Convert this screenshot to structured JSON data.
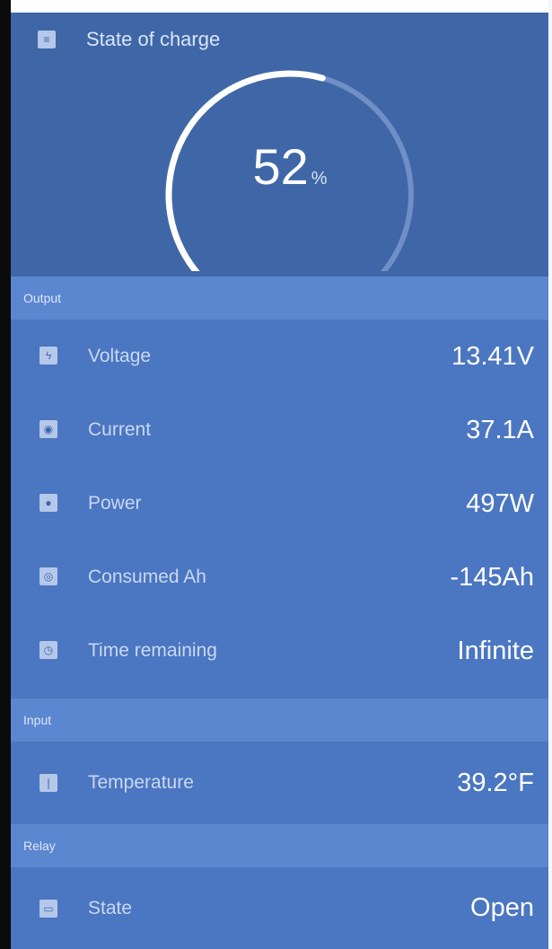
{
  "header": {
    "title": "State of charge",
    "title_icon": "list-icon",
    "soc_value": "52",
    "soc_unit": "%",
    "soc_percent": 52
  },
  "sections": {
    "output": "Output",
    "input": "Input",
    "relay": "Relay"
  },
  "output_rows": [
    {
      "icon": "bolt-icon",
      "label": "Voltage",
      "value": "13.41V"
    },
    {
      "icon": "current-icon",
      "label": "Current",
      "value": "37.1A"
    },
    {
      "icon": "power-icon",
      "label": "Power",
      "value": "497W"
    },
    {
      "icon": "consumed-icon",
      "label": "Consumed Ah",
      "value": "-145Ah"
    },
    {
      "icon": "clock-icon",
      "label": "Time remaining",
      "value": "Infinite"
    }
  ],
  "input_rows": [
    {
      "icon": "thermometer-icon",
      "label": "Temperature",
      "value": "39.2°F"
    }
  ],
  "relay_rows": [
    {
      "icon": "relay-icon",
      "label": "State",
      "value": "Open"
    }
  ],
  "colors": {
    "header_bg": "#3f67a7",
    "section_bg": "#5b86d0",
    "list_bg": "#4b76c1",
    "gauge_active": "#ffffff",
    "gauge_track": "#6f8fc6"
  }
}
